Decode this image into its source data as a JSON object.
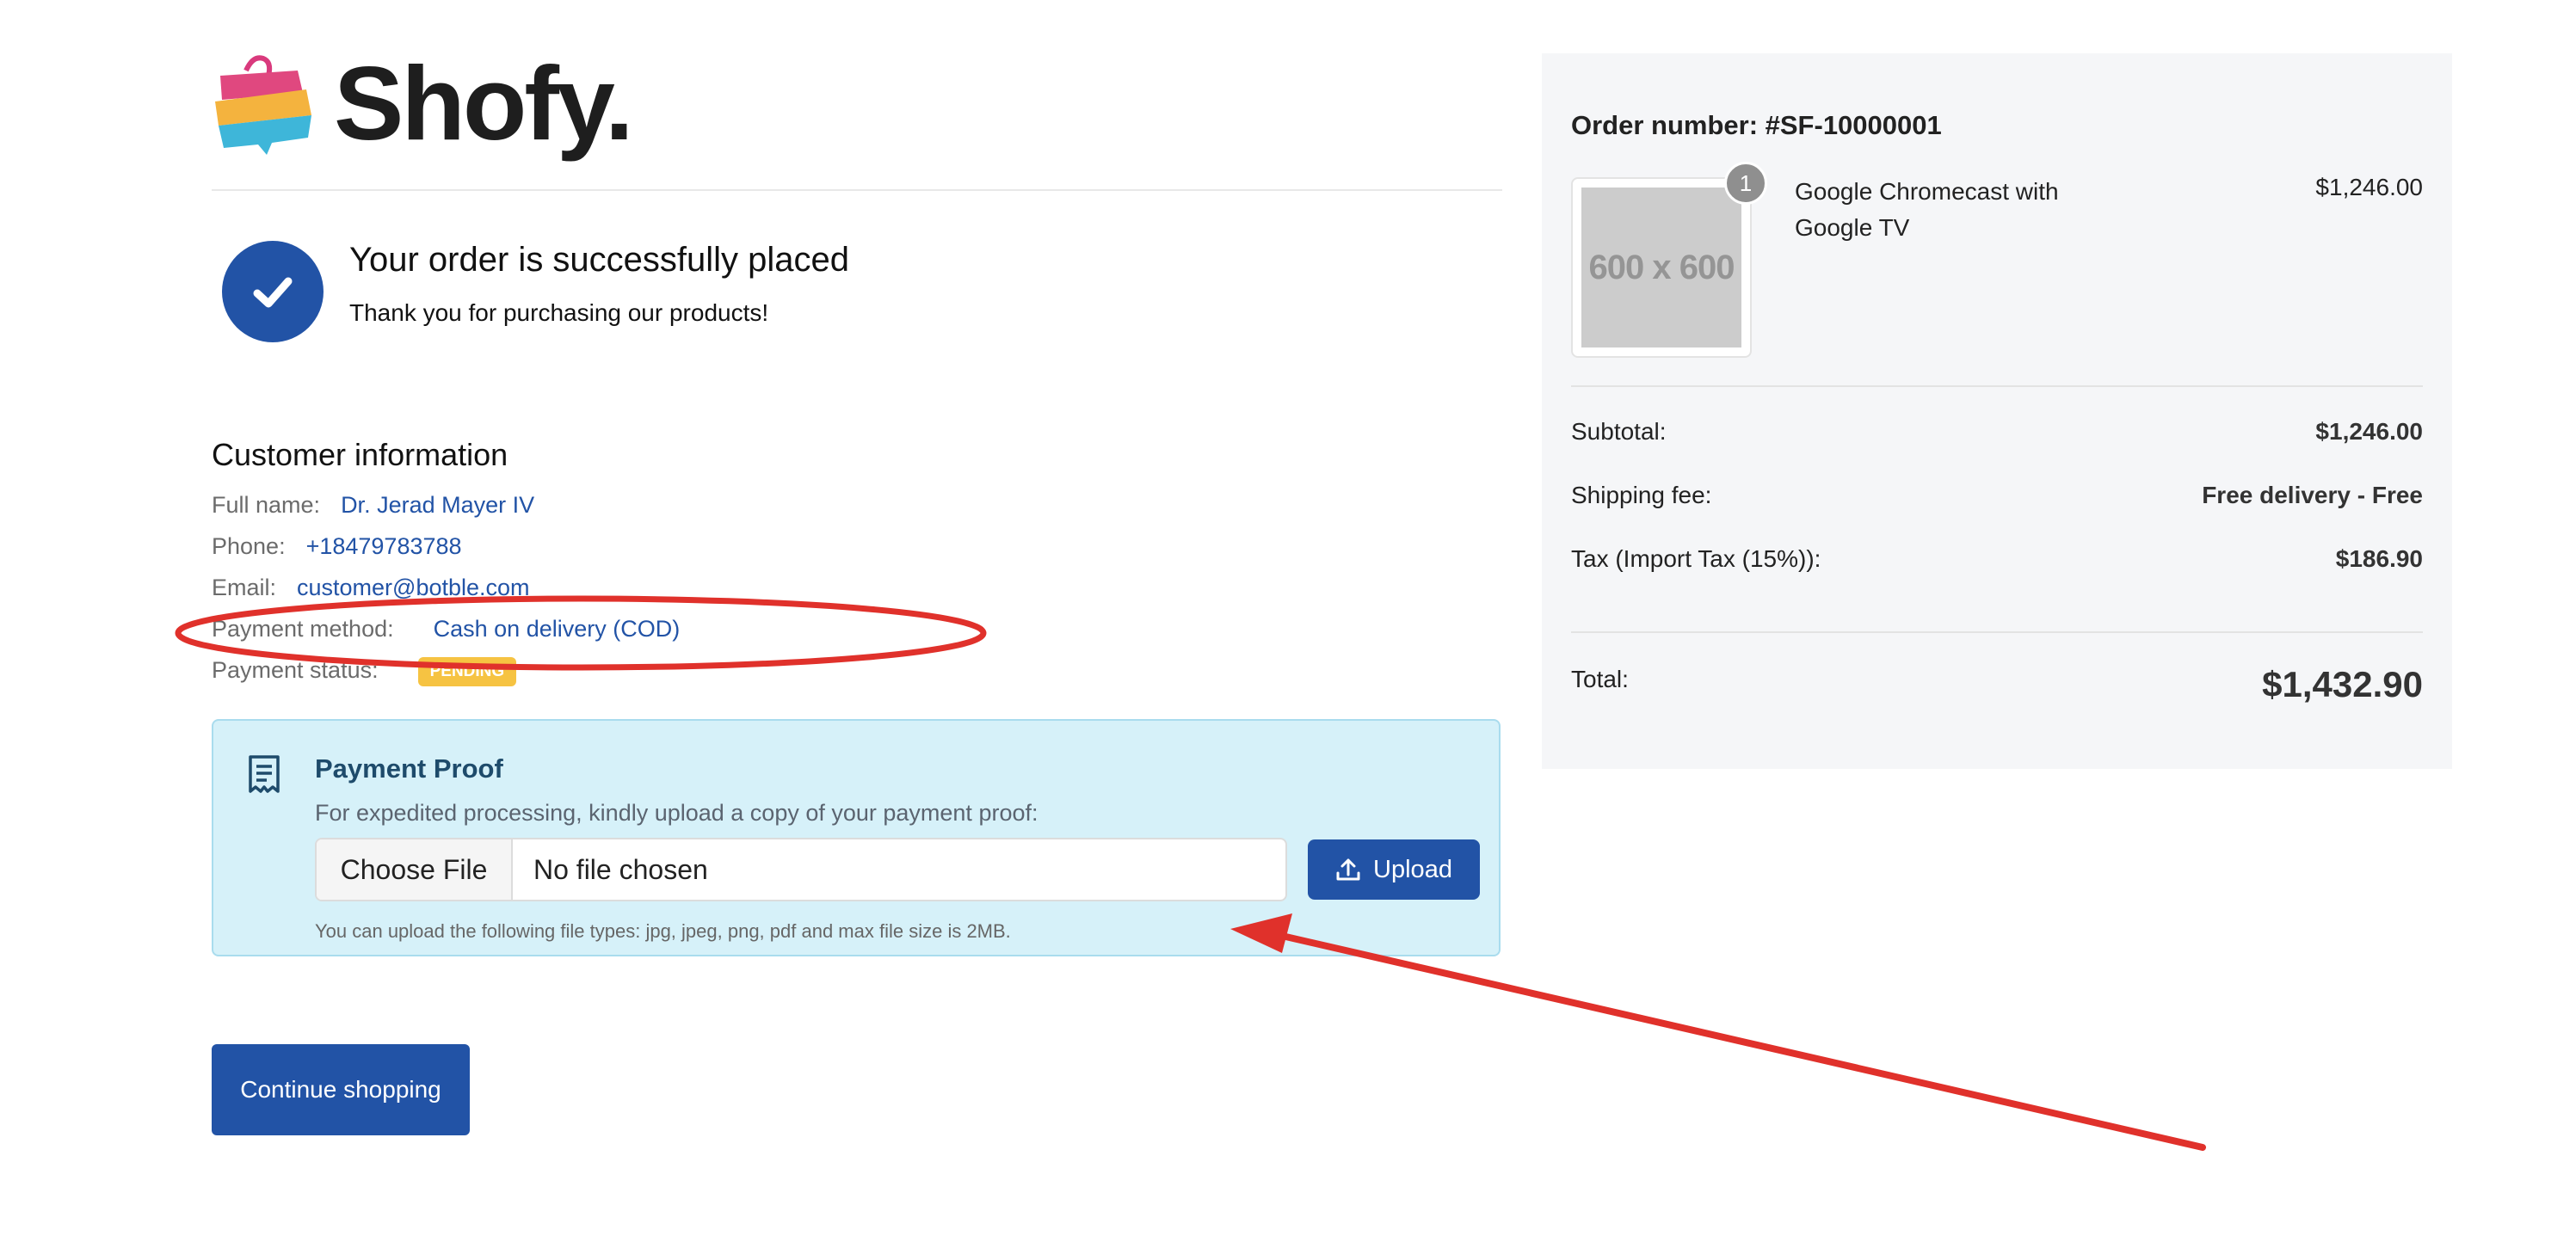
{
  "brand": {
    "name": "Shofy."
  },
  "success": {
    "title": "Your order is successfully placed",
    "subtitle": "Thank you for purchasing our products!"
  },
  "customer": {
    "heading": "Customer information",
    "fields": [
      {
        "label": "Full name:",
        "value": "Dr. Jerad Mayer IV"
      },
      {
        "label": "Phone:",
        "value": "+18479783788"
      },
      {
        "label": "Email:",
        "value": "customer@botble.com"
      },
      {
        "label": "Payment method:",
        "value": "Cash on delivery (COD)"
      }
    ],
    "payment_status_label": "Payment status:",
    "payment_status_badge": "PENDING"
  },
  "payment_proof": {
    "title": "Payment Proof",
    "description": "For expedited processing, kindly upload a copy of your payment proof:",
    "choose_file_label": "Choose File",
    "no_file_text": "No file chosen",
    "upload_label": "Upload",
    "note": "You can upload the following file types: jpg, jpeg, png, pdf and max file size is 2MB."
  },
  "continue_label": "Continue shopping",
  "order": {
    "number_label": "Order number: #SF-10000001",
    "item": {
      "name": "Google Chromecast with Google TV",
      "price": "$1,246.00",
      "quantity": "1",
      "image_placeholder": "600 x 600"
    },
    "subtotal_label": "Subtotal:",
    "subtotal_value": "$1,246.00",
    "shipping_label": "Shipping fee:",
    "shipping_value": "Free delivery - Free",
    "tax_label": "Tax (Import Tax (15%)):",
    "tax_value": "$186.90",
    "total_label": "Total:",
    "total_value": "$1,432.90"
  },
  "colors": {
    "primary": "#2253a6",
    "badge_pending": "#f6c342",
    "proof_bg": "#d6f1f9",
    "annotation_red": "#e0312b"
  },
  "icons": [
    "checkmark-icon",
    "receipt-icon",
    "upload-icon"
  ]
}
